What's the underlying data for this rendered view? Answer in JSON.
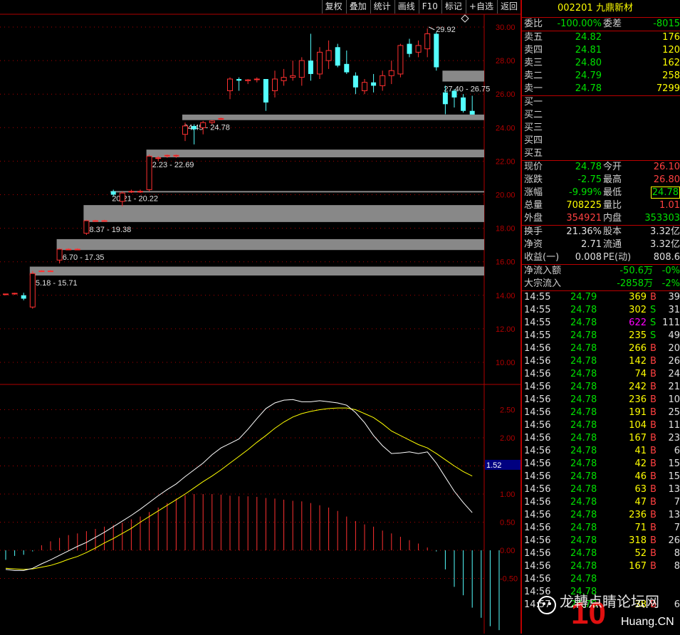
{
  "toolbar": {
    "buttons": [
      "复权",
      "叠加",
      "统计",
      "画线",
      "F10",
      "标记",
      "+自选",
      "返回"
    ]
  },
  "colors": {
    "up": "#ff3030",
    "down": "#54ffff",
    "gap_bar": "#888888",
    "dif": "#ffffff",
    "dea": "#ffff00",
    "grid": "#b00000",
    "axis_text": "#b00000"
  },
  "chart_data": [
    {
      "type": "candlestick",
      "ylim": [
        8.8,
        31.0
      ],
      "y_ticks": [
        "30.00",
        "28.00",
        "26.00",
        "24.00",
        "22.00",
        "20.00",
        "18.00",
        "16.00",
        "14.00",
        "12.00",
        "10.00"
      ],
      "candles": [
        {
          "o": 14.05,
          "h": 14.1,
          "l": 14.0,
          "c": 14.08
        },
        {
          "o": 14.08,
          "h": 14.15,
          "l": 14.03,
          "c": 14.12
        },
        {
          "o": 14.0,
          "h": 14.15,
          "l": 13.7,
          "c": 13.8
        },
        {
          "o": 13.3,
          "h": 15.45,
          "l": 13.2,
          "c": 15.3
        },
        {
          "o": 15.45,
          "h": 15.5,
          "l": 15.4,
          "c": 15.45
        },
        {
          "o": 15.45,
          "h": 15.5,
          "l": 15.4,
          "c": 15.45
        },
        {
          "o": 16.1,
          "h": 16.8,
          "l": 15.9,
          "c": 16.75
        },
        {
          "o": 16.75,
          "h": 16.8,
          "l": 16.7,
          "c": 16.75
        },
        {
          "o": 16.75,
          "h": 16.8,
          "l": 16.7,
          "c": 16.75
        },
        {
          "o": 17.7,
          "h": 18.5,
          "l": 17.6,
          "c": 18.45
        },
        {
          "o": 18.45,
          "h": 18.5,
          "l": 18.4,
          "c": 18.45
        },
        {
          "o": 18.45,
          "h": 18.5,
          "l": 18.4,
          "c": 18.45
        },
        {
          "o": 20.2,
          "h": 20.3,
          "l": 19.9,
          "c": 20.0
        },
        {
          "o": 19.6,
          "h": 20.2,
          "l": 19.3,
          "c": 20.1
        },
        {
          "o": 20.2,
          "h": 20.3,
          "l": 20.1,
          "c": 20.2
        },
        {
          "o": 20.2,
          "h": 20.3,
          "l": 20.1,
          "c": 20.2
        },
        {
          "o": 20.3,
          "h": 22.4,
          "l": 20.2,
          "c": 22.3
        },
        {
          "o": 22.2,
          "h": 22.3,
          "l": 22.0,
          "c": 22.2
        },
        {
          "o": 22.3,
          "h": 22.4,
          "l": 22.2,
          "c": 22.35
        },
        {
          "o": 22.3,
          "h": 22.4,
          "l": 22.2,
          "c": 22.35
        },
        {
          "o": 23.6,
          "h": 24.3,
          "l": 23.2,
          "c": 24.1
        },
        {
          "o": 24.1,
          "h": 24.2,
          "l": 23.0,
          "c": 23.9
        },
        {
          "o": 24.0,
          "h": 24.4,
          "l": 23.6,
          "c": 24.3
        },
        {
          "o": 24.3,
          "h": 24.45,
          "l": 24.2,
          "c": 24.4
        },
        {
          "o": 24.5,
          "h": 24.6,
          "l": 24.45,
          "c": 24.55
        },
        {
          "o": 26.2,
          "h": 27.0,
          "l": 25.7,
          "c": 26.9
        },
        {
          "o": 26.9,
          "h": 27.0,
          "l": 26.2,
          "c": 26.8
        },
        {
          "o": 26.8,
          "h": 26.9,
          "l": 26.6,
          "c": 26.85
        },
        {
          "o": 26.9,
          "h": 27.0,
          "l": 26.7,
          "c": 26.9
        },
        {
          "o": 26.9,
          "h": 26.9,
          "l": 25.0,
          "c": 25.5
        },
        {
          "o": 26.2,
          "h": 27.4,
          "l": 25.8,
          "c": 26.9
        },
        {
          "o": 26.8,
          "h": 27.5,
          "l": 26.5,
          "c": 27.0
        },
        {
          "o": 27.0,
          "h": 28.0,
          "l": 26.8,
          "c": 27.1
        },
        {
          "o": 27.0,
          "h": 28.2,
          "l": 26.5,
          "c": 28.0
        },
        {
          "o": 28.0,
          "h": 29.6,
          "l": 26.8,
          "c": 27.2
        },
        {
          "o": 27.2,
          "h": 28.8,
          "l": 26.9,
          "c": 28.5
        },
        {
          "o": 28.0,
          "h": 29.2,
          "l": 27.5,
          "c": 28.6
        },
        {
          "o": 28.8,
          "h": 29.0,
          "l": 27.6,
          "c": 27.7
        },
        {
          "o": 27.8,
          "h": 28.6,
          "l": 27.2,
          "c": 27.3
        },
        {
          "o": 27.1,
          "h": 27.3,
          "l": 26.0,
          "c": 26.4
        },
        {
          "o": 26.2,
          "h": 26.9,
          "l": 26.0,
          "c": 26.7
        },
        {
          "o": 26.7,
          "h": 27.2,
          "l": 26.1,
          "c": 26.5
        },
        {
          "o": 26.5,
          "h": 27.4,
          "l": 26.2,
          "c": 27.1
        },
        {
          "o": 27.1,
          "h": 28.0,
          "l": 26.6,
          "c": 27.4
        },
        {
          "o": 27.2,
          "h": 29.0,
          "l": 27.0,
          "c": 28.9
        },
        {
          "o": 29.0,
          "h": 29.3,
          "l": 28.2,
          "c": 28.4
        },
        {
          "o": 28.5,
          "h": 29.2,
          "l": 28.2,
          "c": 28.9
        },
        {
          "o": 28.7,
          "h": 29.92,
          "l": 28.2,
          "c": 29.6
        },
        {
          "o": 29.6,
          "h": 29.7,
          "l": 27.4,
          "c": 27.6
        },
        {
          "o": 26.1,
          "h": 26.5,
          "l": 24.8,
          "c": 25.4
        },
        {
          "o": 26.2,
          "h": 26.3,
          "l": 25.2,
          "c": 25.8
        },
        {
          "o": 25.8,
          "h": 26.0,
          "l": 24.9,
          "c": 25.0
        },
        {
          "o": 25.0,
          "h": 25.9,
          "l": 24.78,
          "c": 24.78
        }
      ],
      "gaps": [
        {
          "label": "15.18 - 15.71",
          "low": 15.18,
          "high": 15.71,
          "start": 3
        },
        {
          "label": "16.70 - 17.35",
          "low": 16.7,
          "high": 17.35,
          "start": 6
        },
        {
          "label": "18.37 - 19.38",
          "low": 18.37,
          "high": 19.38,
          "start": 9
        },
        {
          "label": "20.21 - 20.22",
          "low": 20.21,
          "high": 20.22,
          "start": 12
        },
        {
          "label": "22.23 - 22.69",
          "low": 22.23,
          "high": 22.69,
          "start": 16
        },
        {
          "label": "24.45 - 24.78",
          "low": 24.45,
          "high": 24.78,
          "start": 20
        },
        {
          "label": "27.40 - 26.75",
          "low": 26.75,
          "high": 27.4,
          "start": 49
        }
      ],
      "annotations": [
        "29.92"
      ]
    },
    {
      "type": "macd",
      "ylim": [
        -1.4,
        2.9
      ],
      "y_ticks": [
        "2.50",
        "2.00",
        "1.50",
        "1.00",
        "0.50",
        "0.00",
        "-0.50"
      ],
      "current_label": "1.52",
      "dif": [
        -0.34,
        -0.36,
        -0.36,
        -0.32,
        -0.24,
        -0.17,
        -0.09,
        -0.01,
        0.07,
        0.14,
        0.23,
        0.32,
        0.42,
        0.52,
        0.62,
        0.73,
        0.85,
        0.97,
        1.08,
        1.18,
        1.31,
        1.43,
        1.55,
        1.7,
        1.82,
        1.9,
        1.98,
        2.15,
        2.34,
        2.52,
        2.62,
        2.67,
        2.68,
        2.64,
        2.64,
        2.66,
        2.64,
        2.62,
        2.58,
        2.45,
        2.27,
        2.04,
        1.86,
        1.72,
        1.73,
        1.75,
        1.72,
        1.75,
        1.55,
        1.3,
        1.05,
        0.85,
        0.67
      ],
      "dea": [
        -0.32,
        -0.33,
        -0.34,
        -0.33,
        -0.3,
        -0.27,
        -0.22,
        -0.16,
        -0.11,
        -0.04,
        0.04,
        0.13,
        0.21,
        0.3,
        0.39,
        0.5,
        0.6,
        0.7,
        0.8,
        0.9,
        1.0,
        1.11,
        1.22,
        1.32,
        1.43,
        1.55,
        1.67,
        1.79,
        1.92,
        2.04,
        2.17,
        2.28,
        2.37,
        2.43,
        2.47,
        2.5,
        2.52,
        2.53,
        2.53,
        2.5,
        2.43,
        2.36,
        2.25,
        2.12,
        2.04,
        1.96,
        1.88,
        1.82,
        1.72,
        1.61,
        1.5,
        1.4,
        1.32
      ],
      "hist": [
        -0.17,
        -0.1,
        -0.08,
        -0.02,
        0.09,
        0.16,
        0.22,
        0.27,
        0.3,
        0.34,
        0.38,
        0.42,
        0.45,
        0.49,
        0.55,
        0.6,
        0.68,
        0.76,
        0.84,
        0.92,
        0.98,
        1.0,
        1.0,
        1.0,
        0.99,
        0.97,
        0.96,
        0.96,
        0.95,
        0.93,
        0.92,
        0.9,
        0.88,
        0.87,
        0.84,
        0.8,
        0.76,
        0.7,
        0.6,
        0.52,
        0.46,
        0.42,
        0.35,
        0.3,
        0.24,
        0.18,
        0.12,
        0.05,
        -0.02,
        -0.34,
        -0.65,
        -0.8,
        -1.02,
        -1.2,
        -1.35,
        -1.42
      ]
    }
  ],
  "panel": {
    "code": "002201",
    "name": "九鼎新材",
    "weibi_label": "委比",
    "weibi": "-100.00%",
    "weicha_label": "委差",
    "weicha": "-8015",
    "asks": [
      {
        "label": "卖五",
        "price": "24.82",
        "vol": "176"
      },
      {
        "label": "卖四",
        "price": "24.81",
        "vol": "120"
      },
      {
        "label": "卖三",
        "price": "24.80",
        "vol": "162"
      },
      {
        "label": "卖二",
        "price": "24.79",
        "vol": "258"
      },
      {
        "label": "卖一",
        "price": "24.78",
        "vol": "7299"
      }
    ],
    "bids": [
      {
        "label": "买一"
      },
      {
        "label": "买二"
      },
      {
        "label": "买三"
      },
      {
        "label": "买四"
      },
      {
        "label": "买五"
      }
    ],
    "stats": [
      {
        "l1": "现价",
        "v1": "24.78",
        "c1": "g",
        "l2": "今开",
        "v2": "26.10",
        "c2": "r"
      },
      {
        "l1": "涨跌",
        "v1": "-2.75",
        "c1": "g",
        "l2": "最高",
        "v2": "26.80",
        "c2": "r"
      },
      {
        "l1": "涨幅",
        "v1": "-9.99%",
        "c1": "g",
        "l2": "最低",
        "v2": "24.78",
        "c2": "g"
      },
      {
        "l1": "总量",
        "v1": "708225",
        "c1": "y",
        "l2": "量比",
        "v2": "1.01",
        "c2": "r"
      },
      {
        "l1": "外盘",
        "v1": "354921",
        "c1": "r",
        "l2": "内盘",
        "v2": "353303",
        "c2": "g"
      }
    ],
    "stats2": [
      {
        "l1": "换手",
        "v1": "21.36%",
        "l2": "股本",
        "v2": "3.32亿"
      },
      {
        "l1": "净资",
        "v1": "2.71",
        "l2": "流通",
        "v2": "3.32亿"
      },
      {
        "l1": "收益(一)",
        "v1": "0.008",
        "l2": "PE(动)",
        "v2": "808.6"
      }
    ],
    "flow": [
      {
        "label": "净流入额",
        "v": "-50.6万",
        "pct": "-0%"
      },
      {
        "label": "大宗流入",
        "v": "-2858万",
        "pct": "-2%"
      }
    ],
    "ticks": [
      {
        "t": "14:55",
        "p": "24.79",
        "v": "369",
        "bs": "B",
        "n": "39"
      },
      {
        "t": "14:55",
        "p": "24.78",
        "v": "302",
        "bs": "S",
        "n": "31"
      },
      {
        "t": "14:55",
        "p": "24.78",
        "v": "622",
        "bs": "S",
        "n": "111"
      },
      {
        "t": "14:55",
        "p": "24.78",
        "v": "235",
        "bs": "S",
        "n": "49"
      },
      {
        "t": "14:56",
        "p": "24.78",
        "v": "266",
        "bs": "B",
        "n": "20"
      },
      {
        "t": "14:56",
        "p": "24.78",
        "v": "142",
        "bs": "B",
        "n": "26"
      },
      {
        "t": "14:56",
        "p": "24.78",
        "v": "74",
        "bs": "B",
        "n": "24"
      },
      {
        "t": "14:56",
        "p": "24.78",
        "v": "242",
        "bs": "B",
        "n": "21"
      },
      {
        "t": "14:56",
        "p": "24.78",
        "v": "236",
        "bs": "B",
        "n": "10"
      },
      {
        "t": "14:56",
        "p": "24.78",
        "v": "191",
        "bs": "B",
        "n": "25"
      },
      {
        "t": "14:56",
        "p": "24.78",
        "v": "104",
        "bs": "B",
        "n": "11"
      },
      {
        "t": "14:56",
        "p": "24.78",
        "v": "167",
        "bs": "B",
        "n": "23"
      },
      {
        "t": "14:56",
        "p": "24.78",
        "v": "41",
        "bs": "B",
        "n": "6"
      },
      {
        "t": "14:56",
        "p": "24.78",
        "v": "42",
        "bs": "B",
        "n": "15"
      },
      {
        "t": "14:56",
        "p": "24.78",
        "v": "46",
        "bs": "B",
        "n": "15"
      },
      {
        "t": "14:56",
        "p": "24.78",
        "v": "63",
        "bs": "B",
        "n": "13"
      },
      {
        "t": "14:56",
        "p": "24.78",
        "v": "47",
        "bs": "B",
        "n": "7"
      },
      {
        "t": "14:56",
        "p": "24.78",
        "v": "236",
        "bs": "B",
        "n": "13"
      },
      {
        "t": "14:56",
        "p": "24.78",
        "v": "71",
        "bs": "B",
        "n": "7"
      },
      {
        "t": "14:56",
        "p": "24.78",
        "v": "318",
        "bs": "B",
        "n": "26"
      },
      {
        "t": "14:56",
        "p": "24.78",
        "v": "52",
        "bs": "B",
        "n": "8"
      },
      {
        "t": "14:56",
        "p": "24.78",
        "v": "167",
        "bs": "B",
        "n": "8"
      },
      {
        "t": "14:56",
        "p": "24.78",
        "v": "",
        "bs": "",
        "n": ""
      },
      {
        "t": "14:56",
        "p": "24.78",
        "v": "",
        "bs": "",
        "n": ""
      },
      {
        "t": "14:57",
        "p": "24.78",
        "v": "38",
        "bs": "B",
        "n": "6"
      }
    ]
  },
  "watermark": {
    "text": "龙轉点睛论坛网",
    "sub": "Huang.CN",
    "mark": "10"
  }
}
